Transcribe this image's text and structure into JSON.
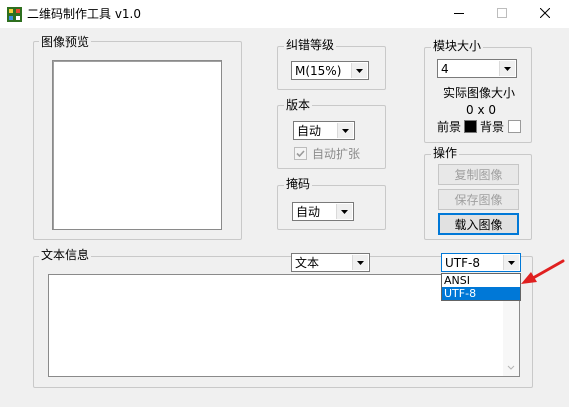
{
  "window": {
    "title": "二维码制作工具 v1.0"
  },
  "preview_group": {
    "label": "图像预览"
  },
  "ecc_group": {
    "label": "纠错等级",
    "selected": "M(15%)"
  },
  "version_group": {
    "label": "版本",
    "selected": "自动",
    "auto_expand_label": "自动扩张"
  },
  "mask_group": {
    "label": "掩码",
    "selected": "自动"
  },
  "module_group": {
    "label": "模块大小",
    "selected": "4",
    "actual_size_label": "实际图像大小",
    "actual_size_value": "0 x 0",
    "fg_label": "前景",
    "bg_label": "背景",
    "fg_color": "#000000",
    "bg_color": "#ffffff"
  },
  "ops_group": {
    "label": "操作",
    "copy_label": "复制图像",
    "save_label": "保存图像",
    "load_label": "载入图像"
  },
  "text_group": {
    "label": "文本信息",
    "mode_selected": "文本",
    "encoding_selected": "UTF-8",
    "encoding_options": [
      "ANSI",
      "UTF-8"
    ],
    "highlighted_option": "UTF-8"
  },
  "colors": {
    "accent": "#0078d7",
    "annotation_arrow": "#e02020"
  },
  "icons": {
    "app": "app-icon",
    "minimize": "minimize-icon",
    "maximize": "maximize-icon",
    "close": "close-icon",
    "dropdown": "chevron-down-icon",
    "check": "check-icon"
  }
}
